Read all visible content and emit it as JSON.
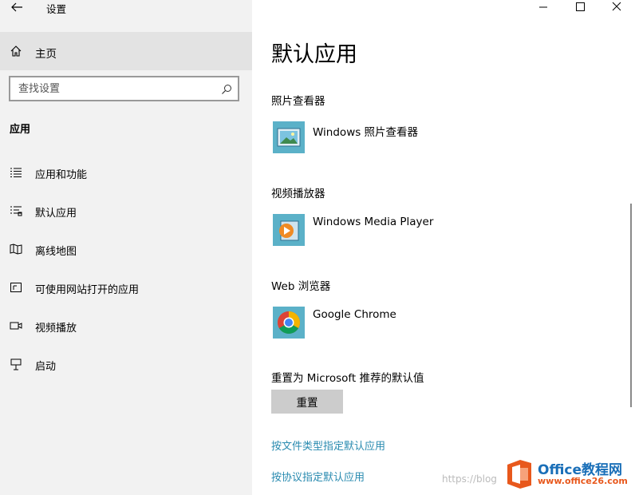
{
  "window": {
    "title": "设置"
  },
  "sidebar": {
    "home_label": "主页",
    "search_placeholder": "查找设置",
    "section_label": "应用",
    "items": [
      {
        "label": "应用和功能",
        "icon": "apps-list-icon"
      },
      {
        "label": "默认应用",
        "icon": "default-apps-icon"
      },
      {
        "label": "离线地图",
        "icon": "offline-map-icon"
      },
      {
        "label": "可使用网站打开的应用",
        "icon": "website-apps-icon"
      },
      {
        "label": "视频播放",
        "icon": "video-playback-icon"
      },
      {
        "label": "启动",
        "icon": "startup-icon"
      }
    ]
  },
  "main": {
    "title": "默认应用",
    "groups": [
      {
        "label": "照片查看器",
        "app": "Windows 照片查看器",
        "icon": "photo-viewer-icon"
      },
      {
        "label": "视频播放器",
        "app": "Windows Media Player",
        "icon": "media-player-icon"
      },
      {
        "label": "Web 浏览器",
        "app": "Google Chrome",
        "icon": "chrome-icon"
      }
    ],
    "reset_label": "重置为 Microsoft 推荐的默认值",
    "reset_button": "重置",
    "links": [
      "按文件类型指定默认应用",
      "按协议指定默认应用"
    ]
  },
  "watermark": {
    "text": "https://blog",
    "brand": "Office教程网",
    "url": "www.office26.com"
  },
  "colors": {
    "accent_link": "#2a8bb0",
    "sidebar_bg": "#f2f2f2",
    "sidebar_selected": "#e3e3e3",
    "icon_tile": "#5bb1c8"
  }
}
